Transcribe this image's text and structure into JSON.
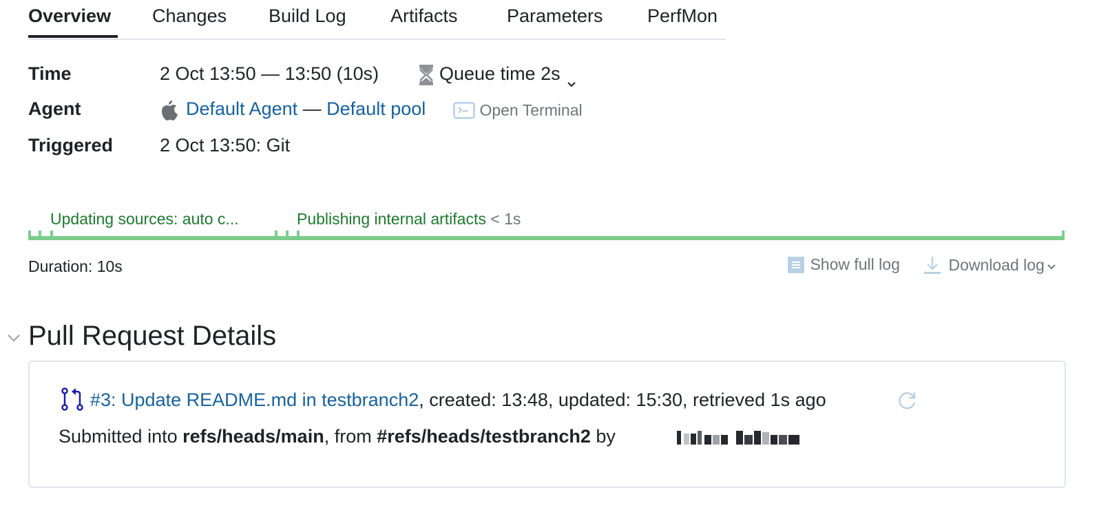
{
  "tabs": [
    {
      "label": "Overview",
      "active": true
    },
    {
      "label": "Changes",
      "active": false
    },
    {
      "label": "Build Log",
      "active": false
    },
    {
      "label": "Artifacts",
      "active": false
    },
    {
      "label": "Parameters",
      "active": false
    },
    {
      "label": "PerfMon",
      "active": false
    }
  ],
  "info": {
    "time_label": "Time",
    "time_value": "2 Oct 13:50 — 13:50 (10s)",
    "queue_icon": "hourglass-icon",
    "queue_time": "Queue time 2s",
    "agent_label": "Agent",
    "agent_os_icon": "apple-icon",
    "agent_name": "Default Agent",
    "agent_sep": "—",
    "agent_pool": "Default pool",
    "terminal_icon": "terminal-icon",
    "open_terminal": "Open Terminal",
    "triggered_label": "Triggered",
    "triggered_value": "2 Oct 13:50: Git"
  },
  "stages": [
    {
      "label": "Updating sources: auto c...",
      "duration": ""
    },
    {
      "label": "Publishing internal artifacts",
      "duration": "< 1s"
    }
  ],
  "colors": {
    "stage_success": "#7ccd8c",
    "stage_text": "#1c7a2c",
    "link": "#15629f",
    "pr_icon": "#1a1fa8"
  },
  "log": {
    "duration": "Duration: 10s",
    "show_full_log": "Show full log",
    "download_log": "Download log"
  },
  "pull_request": {
    "section_title": "Pull Request Details",
    "title_link": "#3: Update README.md in testbranch2",
    "meta": ", created: 13:48, updated: 15:30, retrieved 1s ago",
    "submitted_prefix": "Submitted into ",
    "target_branch": "refs/heads/main",
    "from_text": ", from ",
    "source_branch": "#refs/heads/testbranch2",
    "by_text": " by ",
    "author": "[redacted]"
  }
}
